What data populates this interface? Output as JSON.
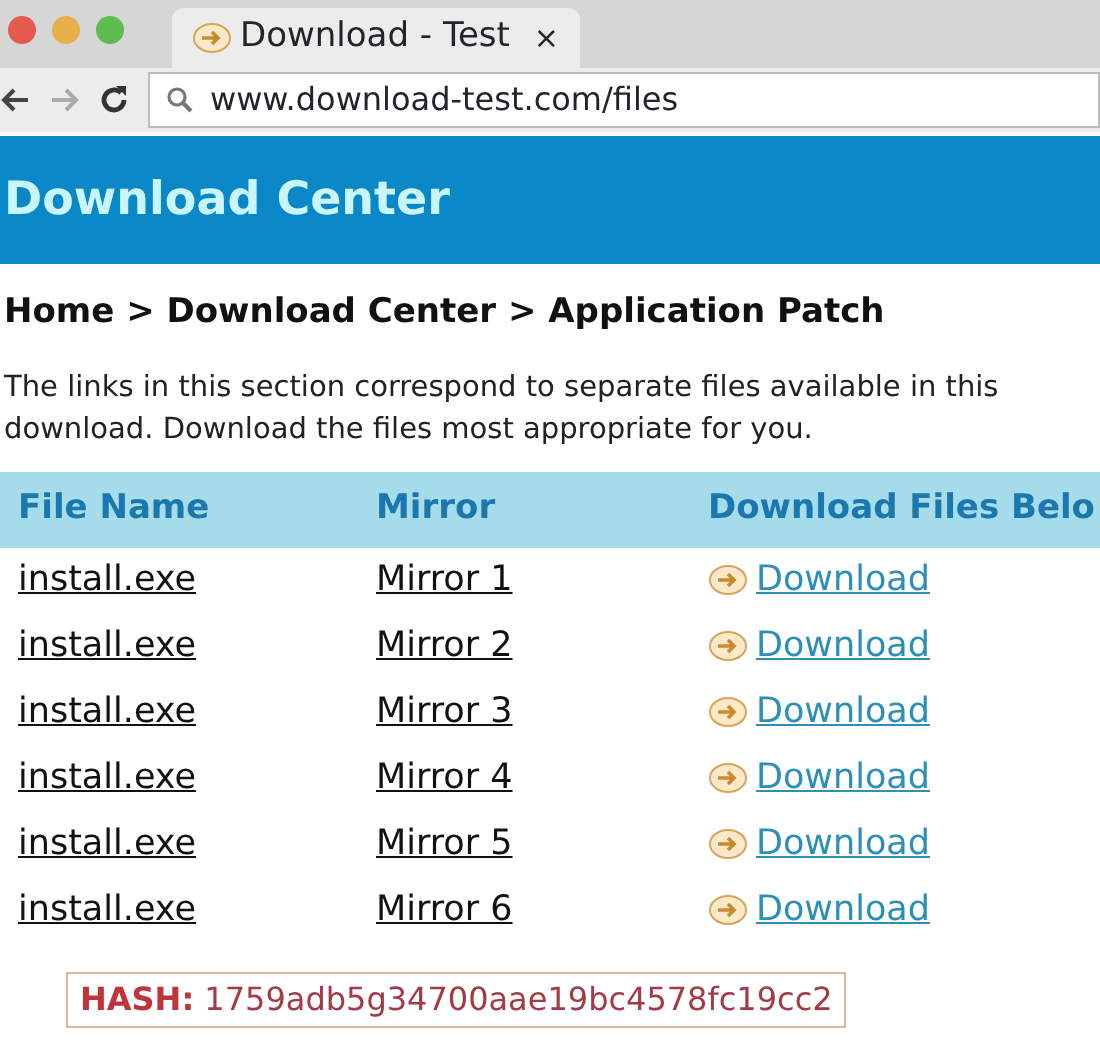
{
  "browser": {
    "tab_title": "Download - Test",
    "tab_close": "×",
    "address": "www.download-test.com/files"
  },
  "header": {
    "title": "Download Center"
  },
  "breadcrumb": "Home > Download Center > Application Patch",
  "intro": "The links in this section correspond to separate files available in this download. Download the files most appropriate for you.",
  "table": {
    "columns": [
      "File Name",
      "Mirror",
      "Download Files Belo"
    ],
    "rows": [
      {
        "file": "install.exe",
        "mirror": "Mirror 1",
        "link": "Download"
      },
      {
        "file": "install.exe",
        "mirror": "Mirror 2",
        "link": "Download"
      },
      {
        "file": "install.exe",
        "mirror": "Mirror 3",
        "link": "Download"
      },
      {
        "file": "install.exe",
        "mirror": "Mirror 4",
        "link": "Download"
      },
      {
        "file": "install.exe",
        "mirror": "Mirror 5",
        "link": "Download"
      },
      {
        "file": "install.exe",
        "mirror": "Mirror 6",
        "link": "Download"
      }
    ]
  },
  "hash": {
    "label": "HASH:",
    "value": "1759adb5g34700aae19bc4578fc19cc2"
  }
}
